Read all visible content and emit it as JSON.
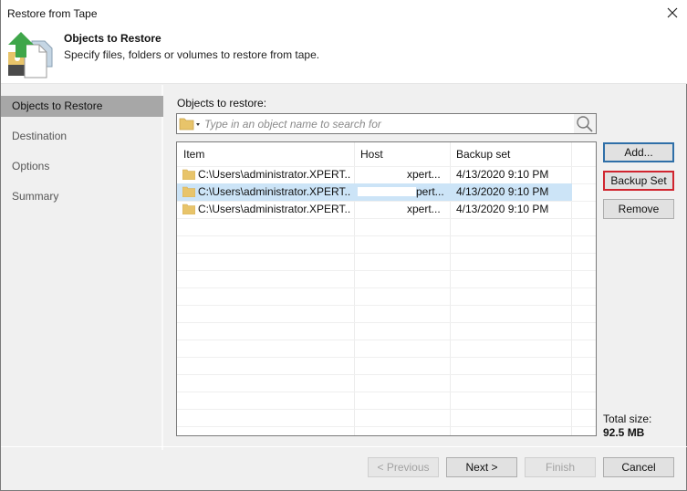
{
  "window": {
    "title": "Restore from Tape",
    "close_icon": "close-icon"
  },
  "header": {
    "title": "Objects to Restore",
    "subtitle": "Specify files, folders or volumes to restore from tape.",
    "icon": "restore-from-tape-icon"
  },
  "sidebar": {
    "items": [
      {
        "label": "Objects to Restore",
        "active": true
      },
      {
        "label": "Destination",
        "active": false
      },
      {
        "label": "Options",
        "active": false
      },
      {
        "label": "Summary",
        "active": false
      }
    ]
  },
  "objects": {
    "label": "Objects to restore:",
    "search": {
      "placeholder": "Type in an object name to search for",
      "value": "",
      "folder_icon": "folder-icon",
      "search_icon": "search-icon"
    },
    "columns": [
      "Item",
      "Host",
      "Backup set"
    ],
    "rows": [
      {
        "item": "C:\\Users\\administrator.XPERT...",
        "host": "xpert...",
        "backup_set": "4/13/2020 9:10 PM",
        "selected": false
      },
      {
        "item": "C:\\Users\\administrator.XPERT...",
        "host": "pert...",
        "backup_set": "4/13/2020 9:10 PM",
        "selected": true
      },
      {
        "item": "C:\\Users\\administrator.XPERT...",
        "host": "xpert...",
        "backup_set": "4/13/2020 9:10 PM",
        "selected": false
      }
    ]
  },
  "actions": {
    "add": "Add...",
    "backup_set": "Backup Set",
    "remove": "Remove"
  },
  "totals": {
    "label": "Total size:",
    "value": "92.5 MB"
  },
  "footer": {
    "previous": "< Previous",
    "next": "Next >",
    "finish": "Finish",
    "cancel": "Cancel"
  }
}
